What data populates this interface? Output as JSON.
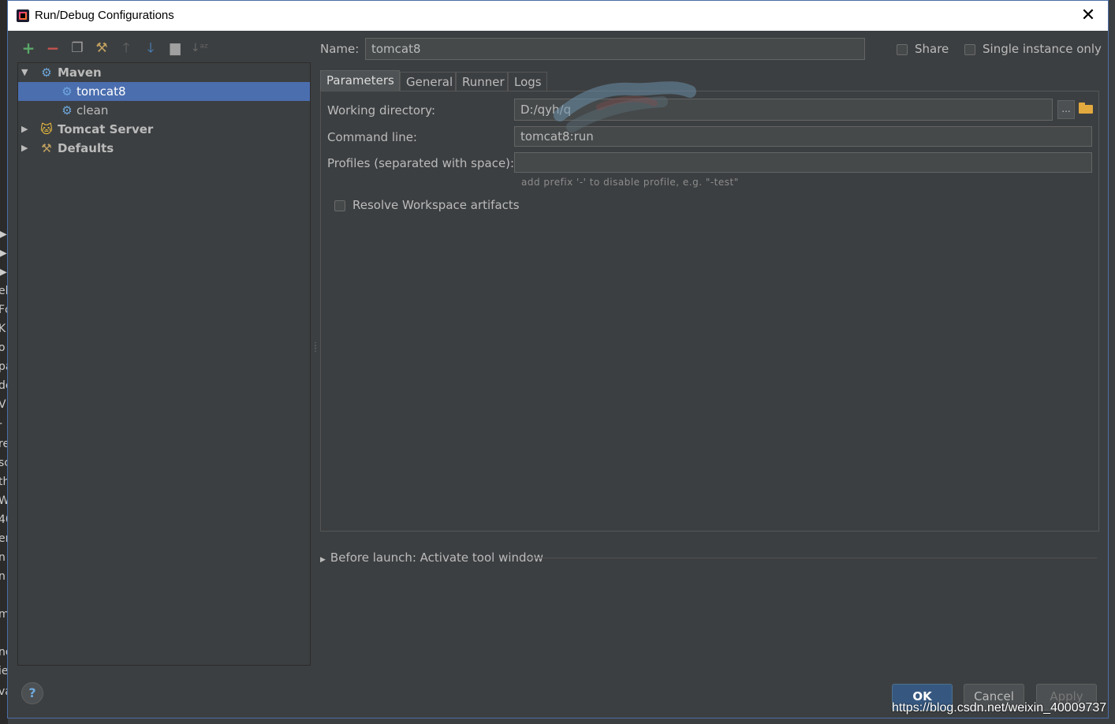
{
  "window": {
    "title": "Run/Debug Configurations"
  },
  "toolbar": {
    "icons": [
      "add-icon",
      "remove-icon",
      "copy-icon",
      "edit-defaults-icon",
      "move-up-icon",
      "move-down-icon",
      "folder-icon",
      "sort-icon"
    ]
  },
  "tree": {
    "maven": {
      "label": "Maven"
    },
    "tomcat8": {
      "label": "tomcat8"
    },
    "clean": {
      "label": "clean"
    },
    "tomcat_server": {
      "label": "Tomcat Server"
    },
    "defaults": {
      "label": "Defaults"
    }
  },
  "header": {
    "name_label": "Name:",
    "name_value": "tomcat8",
    "share_label": "Share",
    "single_instance_label": "Single instance only"
  },
  "tabs": [
    {
      "label": "Parameters",
      "active": true
    },
    {
      "label": "General",
      "active": false
    },
    {
      "label": "Runner",
      "active": false
    },
    {
      "label": "Logs",
      "active": false
    }
  ],
  "parameters": {
    "working_directory_label": "Working directory:",
    "working_directory_value": "D:/qyh/q",
    "browse_label": "...",
    "command_line_label": "Command line:",
    "command_line_value": "tomcat8:run",
    "profiles_label": "Profiles (separated with space):",
    "profiles_value": "",
    "profiles_hint": "add prefix '-' to disable profile, e.g. \"-test\"",
    "resolve_workspace_label": "Resolve Workspace artifacts"
  },
  "before_launch": {
    "label": "Before launch: Activate tool window"
  },
  "buttons": {
    "ok": "OK",
    "cancel": "Cancel",
    "apply": "Apply",
    "help": "?"
  },
  "watermark": "https://blog.csdn.net/weixin_40009737",
  "background_chars": [
    "▶",
    "▶",
    "▶",
    "el",
    "Fc",
    "K",
    "o",
    "pa",
    "de",
    "V",
    "-",
    "re",
    "sc",
    "th",
    "W",
    "40",
    "er",
    "n",
    "n",
    "m",
    "nd",
    "ie",
    "va"
  ],
  "colors": {
    "accent": "#4b6eaf",
    "ok_button": "#365880",
    "background": "#3c3f41"
  }
}
